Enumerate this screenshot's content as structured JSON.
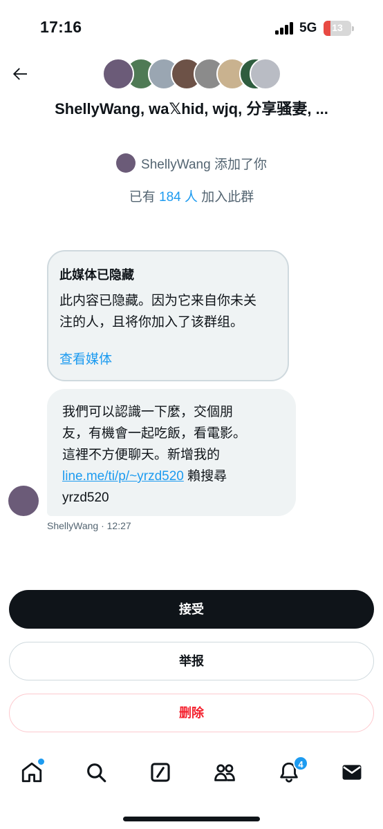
{
  "status_bar": {
    "time": "17:16",
    "network": "5G",
    "battery": "13"
  },
  "header": {
    "group_title": "ShellyWang, wa𝕏hid, wjq, 分享骚妻, ...",
    "avatar_colors": [
      "#6b5b78",
      "#4f7a55",
      "#9aa6b2",
      "#6d5247",
      "#8b8b8b",
      "#c9b28f",
      "#2f5d3f",
      "#b9bcc4"
    ]
  },
  "notices": {
    "added_by_name": "ShellyWang",
    "added_by_text": " 添加了你",
    "members_prefix": "已有 ",
    "members_count": "184 人",
    "members_suffix": " 加入此群"
  },
  "hidden_media": {
    "title": "此媒体已隐藏",
    "body_line1": "此内容已隐藏。因为它来自你未关",
    "body_line2": "注的人，且将你加入了该群组。",
    "view_link": "查看媒体"
  },
  "message": {
    "line1": "我們可以認識一下麼，交個朋",
    "line2": "友，有機會一起吃飯，看電影。",
    "line3": "這裡不方便聊天。新增我的",
    "link": "line.me/ti/p/~yrzd520",
    "after_link": " 賴搜尋",
    "line5": "yrzd520",
    "sender": "ShellyWang",
    "time": " · 12:27"
  },
  "actions": {
    "accept": "接受",
    "report": "举报",
    "delete": "删除"
  },
  "tabbar": {
    "notifications_badge": "4",
    "accent": "#1d9bf0"
  }
}
